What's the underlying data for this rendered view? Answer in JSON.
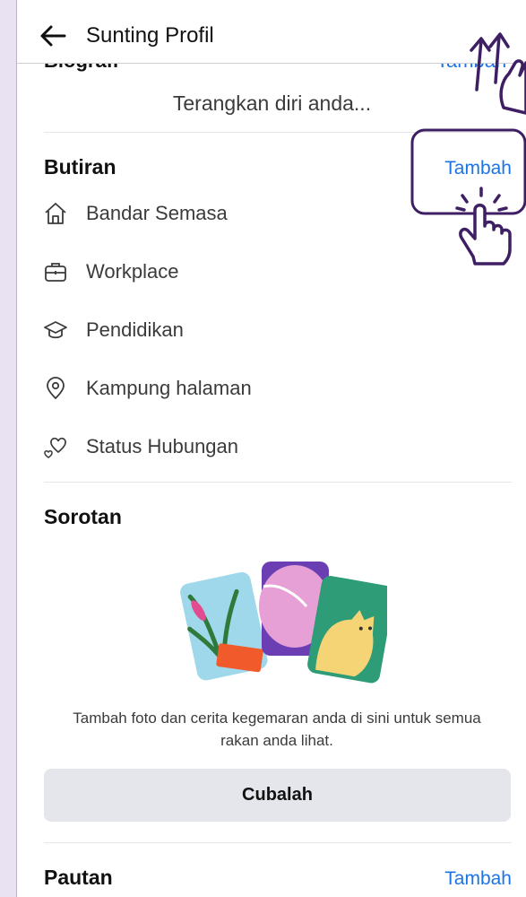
{
  "header": {
    "title": "Sunting Profil"
  },
  "bio": {
    "label": "Biografi",
    "add_label": "Tambah",
    "prompt": "Terangkan diri anda..."
  },
  "details": {
    "title": "Butiran",
    "add_label": "Tambah",
    "items": [
      {
        "label": "Bandar Semasa",
        "icon": "home-icon"
      },
      {
        "label": "Workplace",
        "icon": "briefcase-icon"
      },
      {
        "label": "Pendidikan",
        "icon": "graduation-cap-icon"
      },
      {
        "label": "Kampung halaman",
        "icon": "location-pin-icon"
      },
      {
        "label": "Status Hubungan",
        "icon": "hearts-icon"
      }
    ]
  },
  "highlights": {
    "title": "Sorotan",
    "description": "Tambah foto dan cerita kegemaran anda di sini untuk semua rakan anda lihat.",
    "button_label": "Cubalah"
  },
  "links": {
    "title": "Pautan",
    "add_label": "Tambah"
  },
  "colors": {
    "accent": "#1b74e4",
    "annotation": "#3f1f63",
    "button_bg": "#e4e6eb"
  }
}
